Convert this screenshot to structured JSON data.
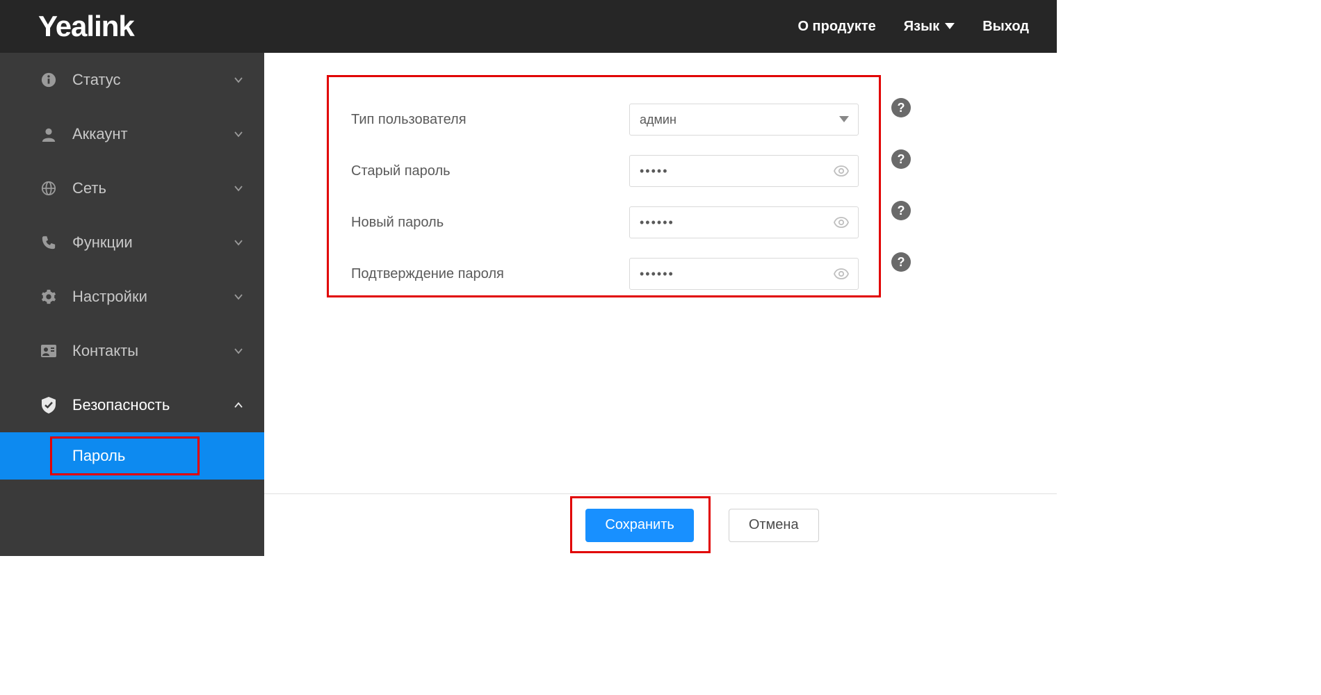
{
  "header": {
    "brand": "Yealink",
    "links": {
      "about": "О продукте",
      "language": "Язык",
      "logout": "Выход"
    }
  },
  "sidebar": {
    "items": {
      "status": "Статус",
      "account": "Аккаунт",
      "network": "Сеть",
      "functions": "Функции",
      "settings": "Настройки",
      "contacts": "Контакты",
      "security": "Безопасность"
    },
    "sub": {
      "password": "Пароль"
    }
  },
  "form": {
    "user_type_label": "Тип пользователя",
    "user_type_value": "админ",
    "old_password_label": "Старый пароль",
    "old_password_value": "•••••",
    "new_password_label": "Новый пароль",
    "new_password_value": "••••••",
    "confirm_password_label": "Подтверждение пароля",
    "confirm_password_value": "••••••"
  },
  "buttons": {
    "save": "Сохранить",
    "cancel": "Отмена"
  },
  "help_glyph": "?"
}
